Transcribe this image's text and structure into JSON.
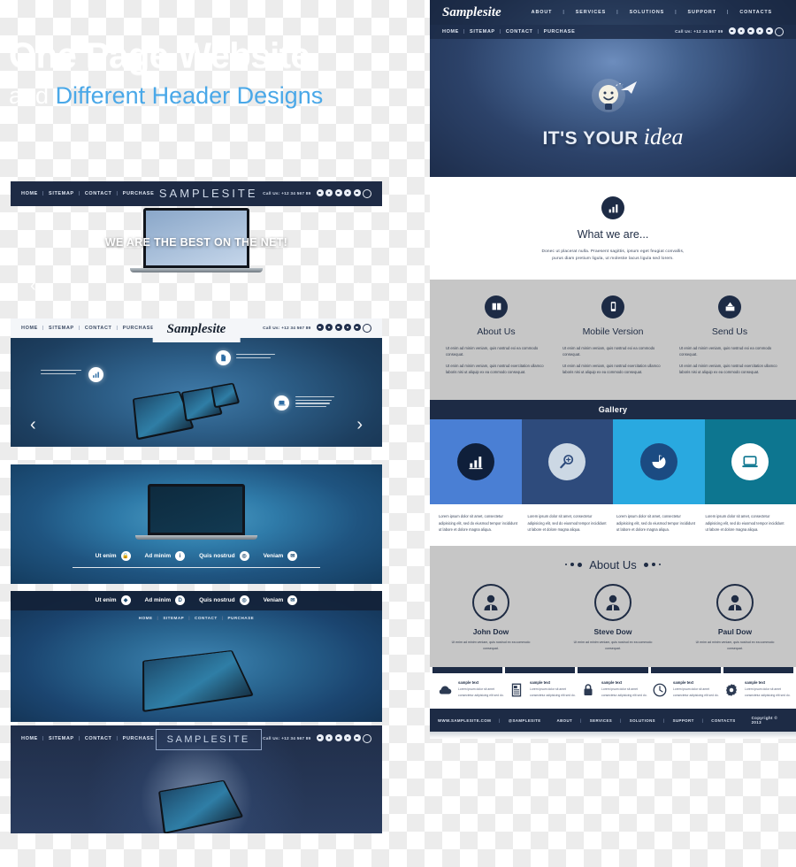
{
  "title": {
    "main": "One Page Website",
    "sub_and": "and ",
    "sub_rest": "Different Header Designs",
    "accent_color": "#4aa8e8"
  },
  "common": {
    "nav": [
      "HOME",
      "SITEMAP",
      "CONTACT",
      "PURCHASE"
    ],
    "separator": "|",
    "call_us": "Call Us: +12 34 567 89",
    "social_count": 6
  },
  "banners": [
    {
      "id": "banner-1",
      "logo": "SAMPLESITE",
      "headline": "WE ARE THE BEST ON THE NET!",
      "prev_arrow": "‹",
      "next_arrow": "›"
    },
    {
      "id": "banner-2",
      "logo": "Samplesite",
      "prev_arrow": "‹",
      "next_arrow": "›",
      "badges": [
        {
          "icon": "bar-chart-icon",
          "lines": 2
        },
        {
          "icon": "document-icon",
          "lines": 2
        },
        {
          "icon": "laptop-icon",
          "lines": 4
        }
      ]
    },
    {
      "id": "banner-3",
      "menu": [
        {
          "label": "Ut enim",
          "icon": "lock-icon",
          "glyph": "■"
        },
        {
          "label": "Ad minim",
          "icon": "info-icon",
          "glyph": "i"
        },
        {
          "label": "Quis nostrud",
          "icon": "target-icon",
          "glyph": "◎"
        },
        {
          "label": "Veniam",
          "icon": "mail-icon",
          "glyph": "✉"
        }
      ]
    },
    {
      "id": "banner-4",
      "menu": [
        {
          "label": "Ut enim",
          "icon": "droplet-icon",
          "glyph": "◆"
        },
        {
          "label": "Ad minim",
          "icon": "document-icon",
          "glyph": "D"
        },
        {
          "label": "Quis nostrud",
          "icon": "target-icon",
          "glyph": "◎"
        },
        {
          "label": "Veniam",
          "icon": "mail-icon",
          "glyph": "✉"
        }
      ],
      "subnav": [
        "HOME",
        "SITEMAP",
        "CONTACT",
        "PURCHASE"
      ]
    },
    {
      "id": "banner-5",
      "logo": "SAMPLESITE"
    }
  ],
  "page": {
    "logo": "Samplesite",
    "main_nav": [
      "ABOUT",
      "SERVICES",
      "SOLUTIONS",
      "SUPPORT",
      "CONTACTS"
    ],
    "sub_nav": [
      "HOME",
      "SITEMAP",
      "CONTACT",
      "PURCHASE"
    ],
    "call_us": "Call Us: +12 34 567 89",
    "hero": {
      "strong": "IT'S YOUR",
      "script": "idea",
      "icon": "lightbulb-icon"
    },
    "what_we_are": {
      "icon": "bar-chart-icon",
      "title": "What we are...",
      "body_line1": "Donec ut placerat nulla. Praesent sagittis, ipsum eget feugiat convallis,",
      "body_line2": "purus diam pretium ligula, ut molestie lacus ligula sed lorem."
    },
    "columns": [
      {
        "icon": "book-icon",
        "title": "About Us",
        "p1": "Ut enim ad minim veniam, quis nostrud exi ea commodo consequat.",
        "p2": "Ut enim ad minim veniam, quis nostrud exercitation ullamco laboris nisi ut aliquip ex ea commodo consequat."
      },
      {
        "icon": "mobile-icon",
        "title": "Mobile Version",
        "p1": "Ut enim ad minim veniam, quis nostrud exi ea commodo consequat.",
        "p2": "Ut enim ad minim veniam, quis nostrud exercitation ullamco laboris nisi ut aliquip ex ea commodo consequat."
      },
      {
        "icon": "envelope-icon",
        "title": "Send Us",
        "p1": "Ut enim ad minim veniam, quis nostrud exi ea commodo consequat.",
        "p2": "Ut enim ad minim veniam, quis nostrud exercitation ullamco laboris nisi ut aliquip ex ea commodo consequat."
      }
    ],
    "gallery": {
      "title": "Gallery",
      "tiles": [
        {
          "bg": "#4a7fd4",
          "icon": "bar-chart-icon",
          "circle_bg": "#0f1f3a",
          "icon_color": "#ffffff"
        },
        {
          "bg": "#2e4b7c",
          "icon": "search-zoom-icon",
          "circle_bg": "#ccd8e4",
          "icon_color": "#2e4b7c"
        },
        {
          "bg": "#29a9e0",
          "icon": "pie-chart-icon",
          "circle_bg": "#1b4b82",
          "icon_color": "#ffffff"
        },
        {
          "bg": "#0d7690",
          "icon": "laptop-icon",
          "circle_bg": "#ffffff",
          "icon_color": "#0d7690"
        }
      ],
      "captions": [
        "Lorem ipsum dolor sit amet, consectetur adipisicing elit, sed do eiusmod tempor incididunt ut labore et dolore magna aliqua.",
        "Lorem ipsum dolor sit amet, consectetur adipisicing elit, sed do eiusmod tempor incididunt ut labore et dolore magna aliqua.",
        "Lorem ipsum dolor sit amet, consectetur adipisicing elit, sed do eiusmod tempor incididunt ut labore et dolore magna aliqua.",
        "Lorem ipsum dolor sit amet, consectetur adipisicing elit, sed do eiusmod tempor incididunt ut labore et dolore magna aliqua."
      ]
    },
    "about_us": {
      "title": "About Us",
      "team": [
        {
          "name": "John Dow",
          "icon": "user-avatar-icon",
          "bio": "Ut enim ad minim veniam, quis nostrud ex ea commodo consequat."
        },
        {
          "name": "Steve Dow",
          "icon": "user-avatar-icon",
          "bio": "Ut enim ad minim veniam, quis nostrud ex ea commodo consequat."
        },
        {
          "name": "Paul Dow",
          "icon": "user-avatar-icon",
          "bio": "Ut enim ad minim veniam, quis nostrud ex ea commodo consequat."
        }
      ]
    },
    "features": [
      {
        "icon": "cloud-icon",
        "title": "sample text",
        "body": "Lorem ipsum dolor sit amet consectetur adipisicing elit sed do."
      },
      {
        "icon": "server-icon",
        "title": "sample text",
        "body": "Lorem ipsum dolor sit amet consectetur adipisicing elit sed do."
      },
      {
        "icon": "lock-icon",
        "title": "sample text",
        "body": "Lorem ipsum dolor sit amet consectetur adipisicing elit sed do."
      },
      {
        "icon": "clock-icon",
        "title": "sample text",
        "body": "Lorem ipsum dolor sit amet consectetur adipisicing elit sed do."
      },
      {
        "icon": "gear-icon",
        "title": "sample text",
        "body": "Lorem ipsum dolor sit amet consectetur adipisicing elit sed do."
      }
    ],
    "footer": {
      "site": "WWW.SAMPLESITE.COM",
      "handle": "@SAMPLESITE",
      "links": [
        "ABOUT",
        "SERVICES",
        "SOLUTIONS",
        "SUPPORT",
        "CONTACTS"
      ],
      "copyright": "Copyright © 2013"
    }
  }
}
